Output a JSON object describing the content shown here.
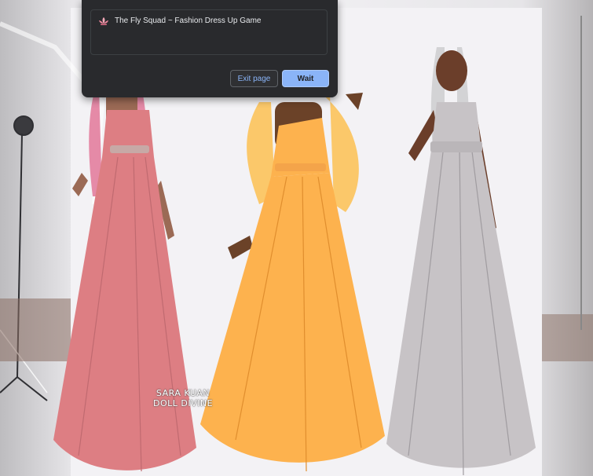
{
  "dialog": {
    "title": "The Fly Squad ~ Fashion Dress Up Game",
    "site_icon": "lotus-icon",
    "buttons": {
      "exit": "Exit page",
      "wait": "Wait"
    }
  },
  "game": {
    "watermark_line1": "SARA KUAN",
    "watermark_line2": "DOLL DIVINE",
    "dolls": [
      {
        "name": "pink-gown-doll",
        "gown_color": "#dd7e83"
      },
      {
        "name": "orange-gown-doll",
        "gown_color": "#fdb24e"
      },
      {
        "name": "silver-gown-doll",
        "gown_color": "#c7c3c6"
      }
    ]
  },
  "colors": {
    "accent": "#8ab4f8",
    "dialog_bg": "#292a2d"
  }
}
